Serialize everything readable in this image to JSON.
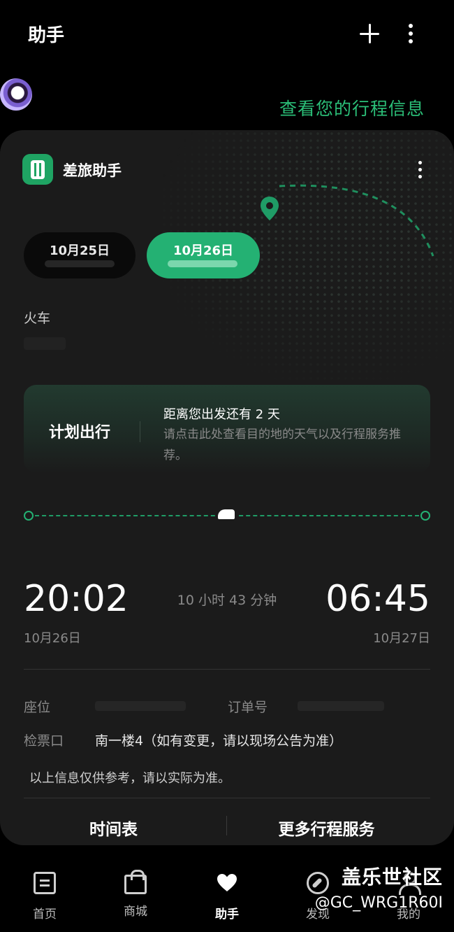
{
  "header": {
    "title": "助手"
  },
  "banner": {
    "text": "查看您的行程信息"
  },
  "card": {
    "app_name": "差旅助手",
    "dates": [
      {
        "label": "10月25日",
        "selected": false
      },
      {
        "label": "10月26日",
        "selected": true
      }
    ],
    "transport_type": "火车",
    "plan": {
      "title": "计划出行",
      "countdown": "距离您出发还有 2 天",
      "description": "请点击此处查看目的地的天气以及行程服务推荐。"
    },
    "trip": {
      "departure_time": "20:02",
      "departure_date": "10月26日",
      "duration": "10 小时 43 分钟",
      "arrival_time": "06:45",
      "arrival_date": "10月27日"
    },
    "details": {
      "seat_label": "座位",
      "order_label": "订单号",
      "gate_label": "检票口",
      "gate_value": "南一楼4（如有变更，请以现场公告为准）",
      "note": "以上信息仅供参考，请以实际为准。"
    },
    "actions": {
      "schedule": "时间表",
      "more_services": "更多行程服务"
    }
  },
  "bottom_nav": [
    {
      "label": "首页",
      "icon": "home-icon",
      "active": false
    },
    {
      "label": "商城",
      "icon": "shopping-bag-icon",
      "active": false
    },
    {
      "label": "助手",
      "icon": "heart-icon",
      "active": true
    },
    {
      "label": "发现",
      "icon": "compass-icon",
      "active": false
    },
    {
      "label": "我的",
      "icon": "user-icon",
      "active": false
    }
  ],
  "watermark": {
    "line1": "盖乐世社区",
    "line2": "@GC_WRG1R60I"
  },
  "colors": {
    "accent": "#24b173",
    "background": "#000000",
    "card": "#1b1b1b"
  }
}
